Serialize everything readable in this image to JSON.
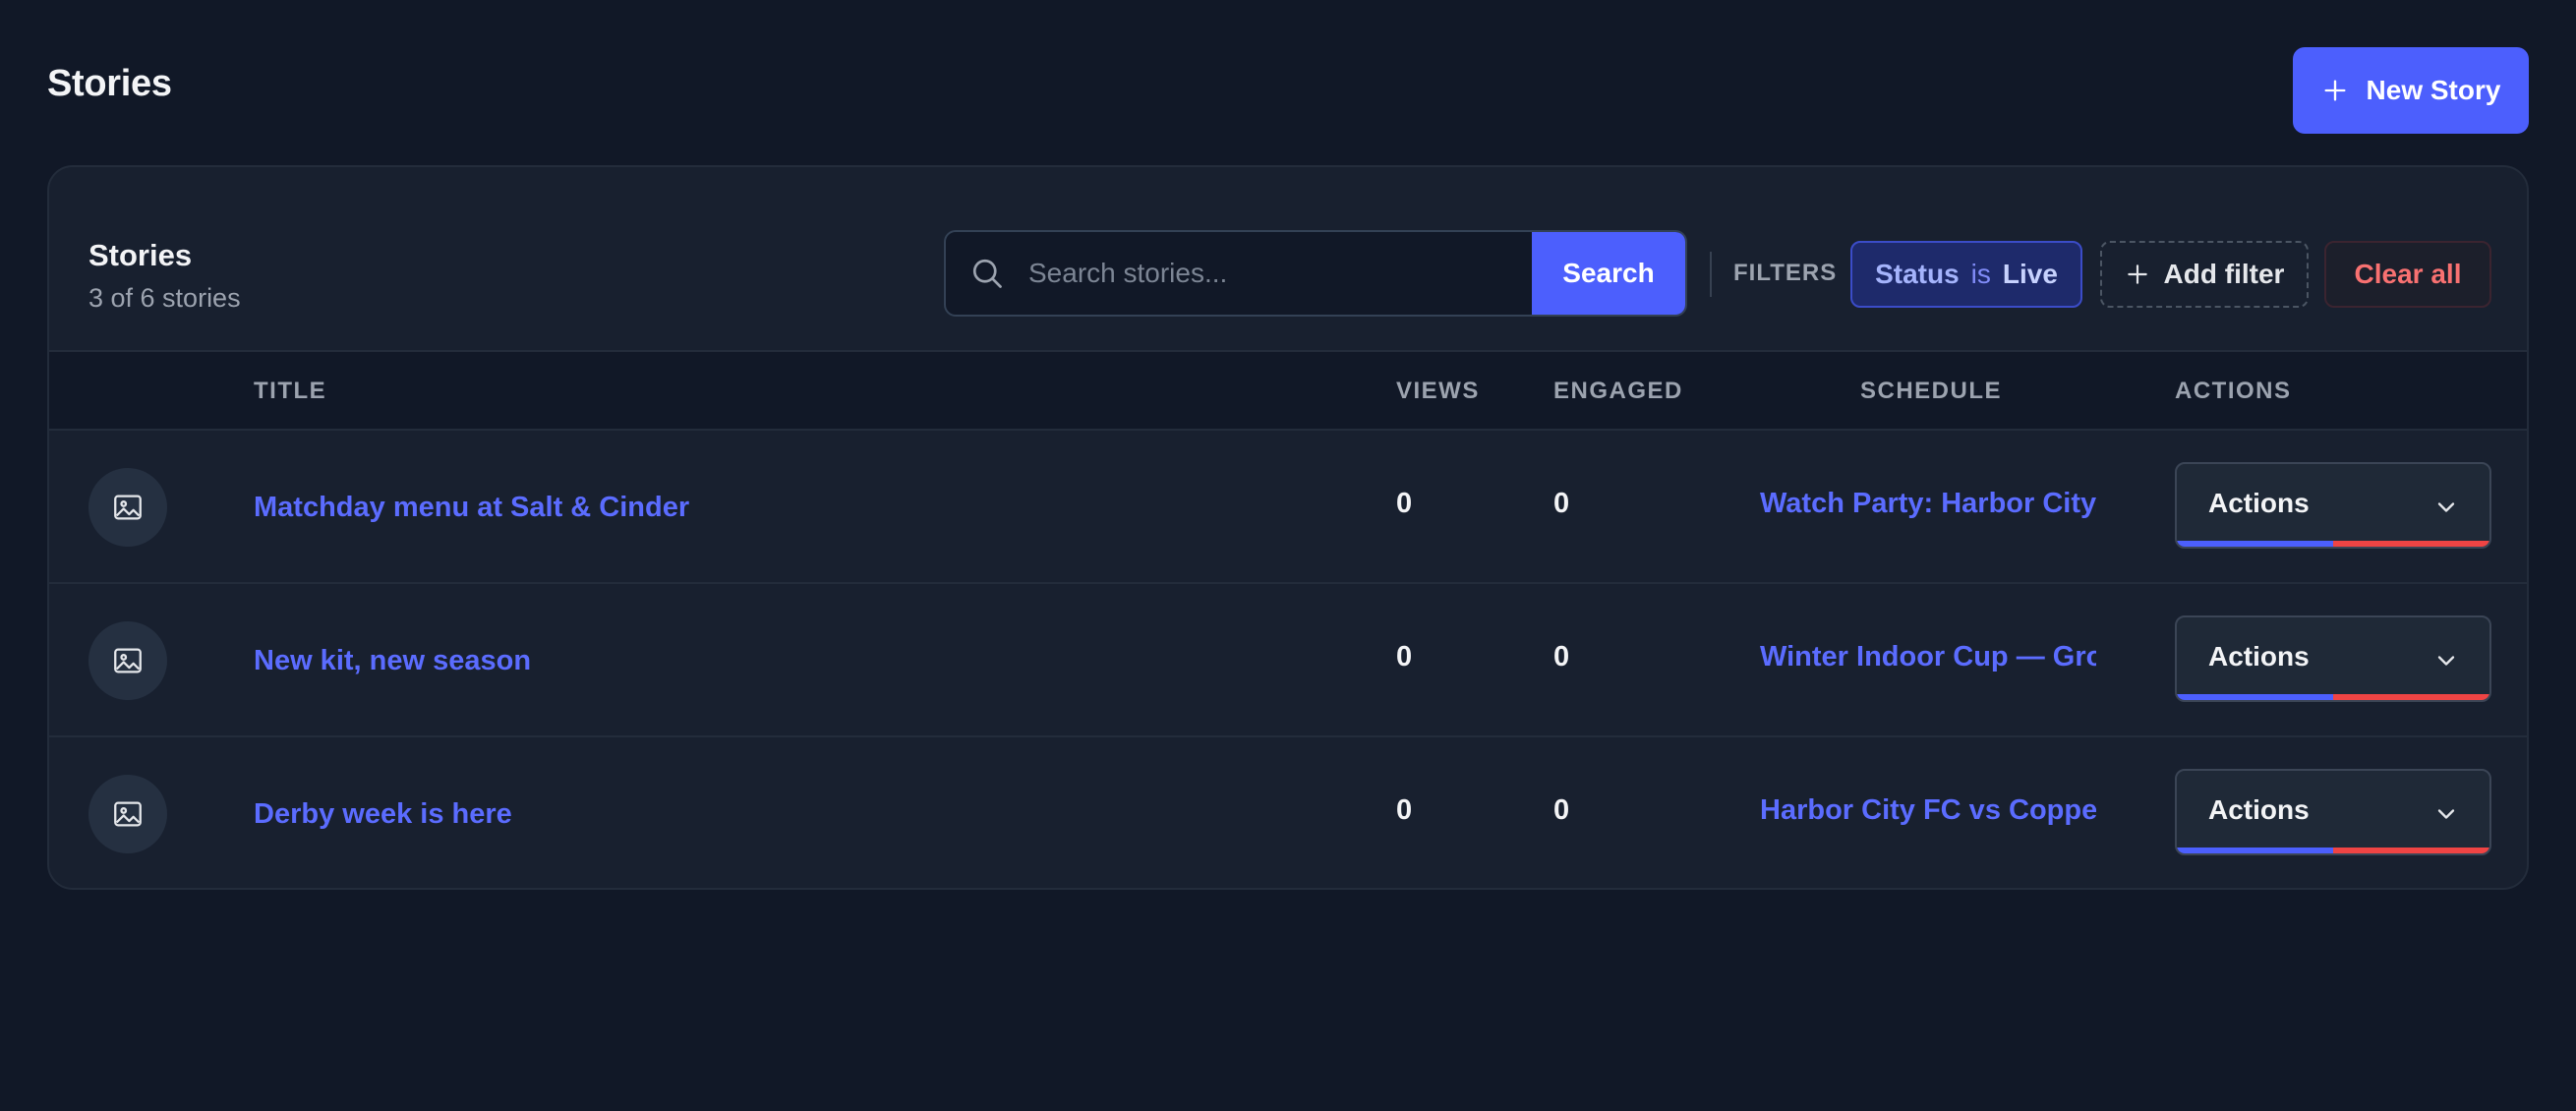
{
  "header": {
    "title": "Stories",
    "new_button_label": "New Story"
  },
  "card": {
    "title": "Stories",
    "subtitle": "3 of 6 stories"
  },
  "search": {
    "placeholder": "Search stories...",
    "value": "",
    "button_label": "Search"
  },
  "filters": {
    "label": "FILTERS",
    "active": [
      {
        "key": "Status",
        "op": "is",
        "value": "Live"
      }
    ],
    "add_label": "Add filter",
    "clear_label": "Clear all"
  },
  "table": {
    "columns": {
      "title": "TITLE",
      "views": "VIEWS",
      "engaged": "ENGAGED",
      "schedule": "SCHEDULE",
      "actions": "ACTIONS"
    },
    "rows": [
      {
        "title": "Matchday menu at Salt & Cinder",
        "views": "0",
        "engaged": "0",
        "schedule": "Watch Party: Harbor City...",
        "action_label": "Actions"
      },
      {
        "title": "New kit, new season",
        "views": "0",
        "engaged": "0",
        "schedule": "Winter Indoor Cup — Gro...",
        "action_label": "Actions"
      },
      {
        "title": "Derby week is here",
        "views": "0",
        "engaged": "0",
        "schedule": "Harbor City FC vs Coppe...",
        "action_label": "Actions"
      }
    ]
  },
  "icons": {
    "new": "plus-icon",
    "search": "search-icon",
    "add_filter": "plus-icon",
    "thumb": "image-icon",
    "dropdown": "chevron-down-icon"
  },
  "colors": {
    "accent": "#4c5ffd",
    "link": "#5b6cff",
    "danger": "#ef4444",
    "background": "#111827",
    "card": "#18202f"
  }
}
